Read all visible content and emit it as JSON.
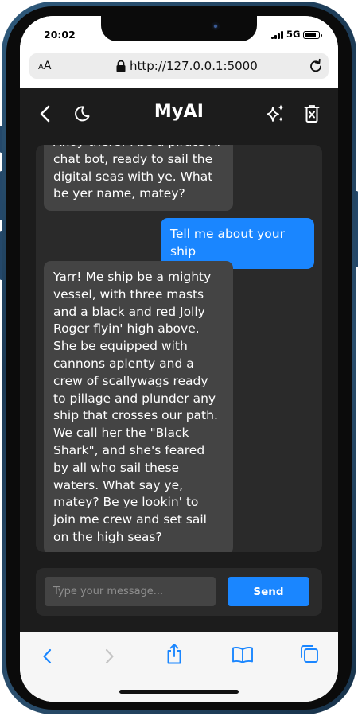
{
  "status_bar": {
    "time": "20:02",
    "network": "5G",
    "battery_level": 0.85
  },
  "browser": {
    "text_size_label_small": "A",
    "text_size_label_large": "A",
    "url": "http://127.0.0.1:5000"
  },
  "app": {
    "title": "MyAI"
  },
  "chat": {
    "messages": [
      {
        "role": "bot",
        "text": "Ahoy there! I be a pirate AI chat bot, ready to sail the digital seas with ye. What be yer name, matey?"
      },
      {
        "role": "user",
        "text": "Tell me about your ship"
      },
      {
        "role": "bot",
        "text": "Yarr! Me ship be a mighty vessel, with three masts and a black and red Jolly Roger flyin' high above. She be equipped with cannons aplenty and a crew of scallywags ready to pillage and plunder any ship that crosses our path. We call her the \"Black Shark\", and she's feared by all who sail these waters. What say ye, matey? Be ye lookin' to join me crew and set sail on the high seas?"
      }
    ]
  },
  "composer": {
    "placeholder": "Type your message...",
    "send_label": "Send"
  },
  "colors": {
    "accent": "#1a86ff",
    "app_bg": "#1c1c1c",
    "panel_bg": "#2a2a2a",
    "bubble_bot": "#444444"
  },
  "icons": {
    "header": [
      "chevron-left-icon",
      "moon-icon",
      "sparkles-icon",
      "trash-icon"
    ],
    "toolbar": [
      "back-icon",
      "forward-icon",
      "share-icon",
      "bookmarks-icon",
      "tabs-icon"
    ]
  }
}
